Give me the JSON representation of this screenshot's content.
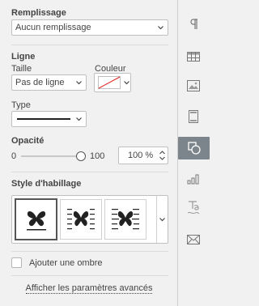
{
  "fill": {
    "heading": "Remplissage",
    "value": "Aucun remplissage"
  },
  "line": {
    "heading": "Ligne",
    "size_label": "Taille",
    "size_value": "Pas de ligne",
    "color_label": "Couleur",
    "type_label": "Type"
  },
  "opacity": {
    "heading": "Opacité",
    "min": "0",
    "max": "100",
    "value": "100 %",
    "level": 1.0
  },
  "wrap": {
    "heading": "Style d'habillage"
  },
  "shadow": {
    "label": "Ajouter une ombre",
    "checked": false
  },
  "advanced_link": "Afficher les paramètres avancés",
  "sidebar_icons": [
    "paragraph-icon",
    "table-icon",
    "image-icon",
    "header-footer-icon",
    "shape-icon",
    "chart-icon",
    "text-art-icon",
    "mail-merge-icon"
  ],
  "colors": {
    "accent_selected": "#7d858c",
    "link": "#444444"
  }
}
